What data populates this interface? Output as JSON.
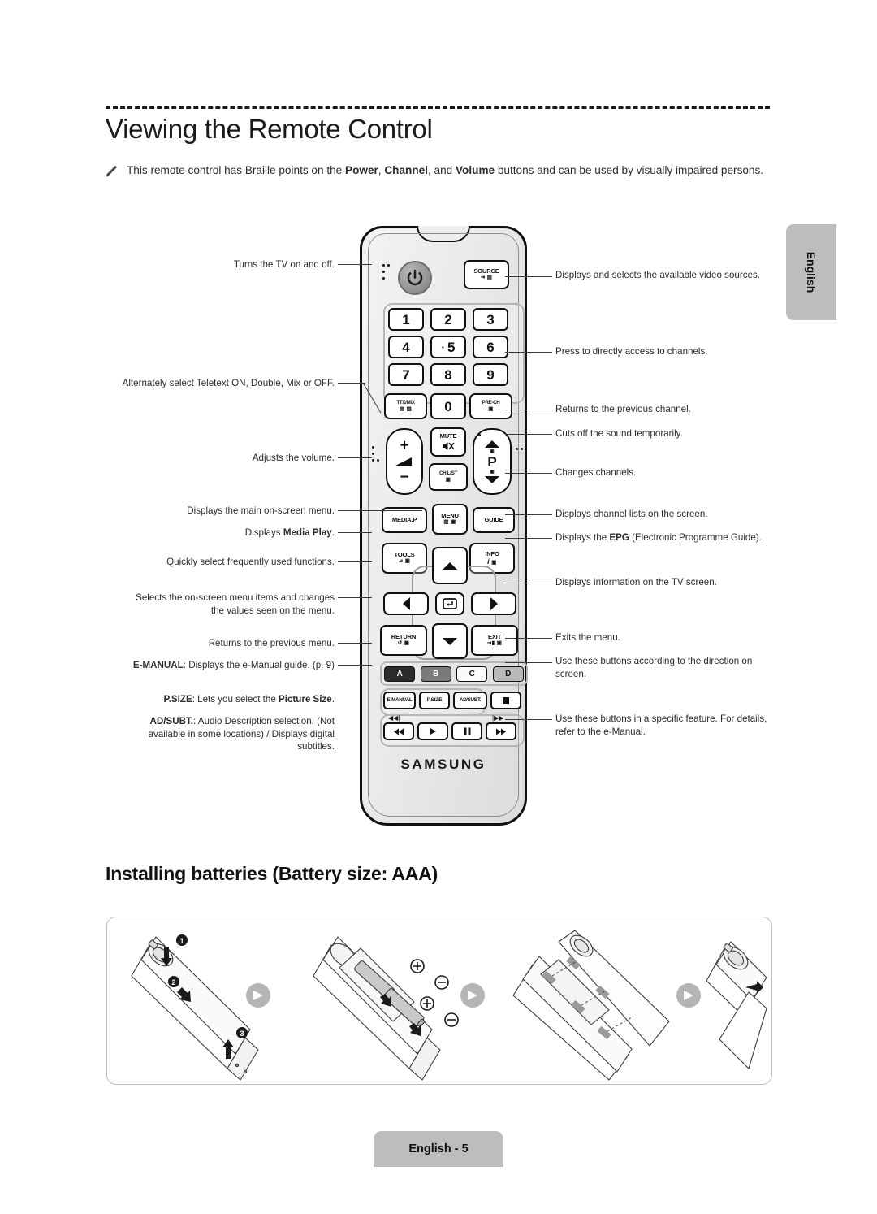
{
  "header": {
    "title": "Viewing the Remote Control",
    "note_icon": "pencil-note-icon",
    "note_parts": {
      "p1": "This remote control has Braille points on the ",
      "b1": "Power",
      "p2": ", ",
      "b2": "Channel",
      "p3": ", and ",
      "b3": "Volume",
      "p4": " buttons and can be used by visually impaired persons."
    }
  },
  "side_tab": {
    "label": "English"
  },
  "remote": {
    "brand": "SAMSUNG",
    "buttons": {
      "source": "SOURCE",
      "n1": "1",
      "n2": "2",
      "n3": "3",
      "n4": "4",
      "n5": "5",
      "n6": "6",
      "n7": "7",
      "n8": "8",
      "n9": "9",
      "n0": "0",
      "ttxmix": "TTX/MIX",
      "precch": "PRE-CH",
      "mute": "MUTE",
      "chlist": "CH LIST",
      "p": "P",
      "mediap": "MEDIA.P",
      "menu": "MENU",
      "guide": "GUIDE",
      "tools": "TOOLS",
      "info": "INFO",
      "return": "RETURN",
      "exit": "EXIT",
      "color_a": "A",
      "color_b": "B",
      "color_c": "C",
      "color_d": "D",
      "emanual": "E-MANUAL",
      "psize": "P.SIZE",
      "adsubt": "AD/SUBT."
    },
    "icons": {
      "power": "power-icon",
      "volume": "volume-icon",
      "plus": "plus-icon",
      "minus": "minus-icon",
      "up": "chevron-up-icon",
      "down": "chevron-down-icon",
      "left": "chevron-left-icon",
      "right": "chevron-right-icon",
      "enter": "enter-icon",
      "mute": "mute-speaker-icon",
      "stop": "stop-icon",
      "rewind": "rewind-icon",
      "play": "play-icon",
      "pause": "pause-icon",
      "fastforward": "fast-forward-icon",
      "prev_track": "previous-track-icon",
      "next_track": "next-track-icon"
    }
  },
  "annotations": {
    "left": [
      {
        "id": "power",
        "text": "Turns the TV on and off."
      },
      {
        "id": "ttxmix",
        "text": "Alternately select Teletext ON, Double, Mix or OFF."
      },
      {
        "id": "volume",
        "text": "Adjusts the volume."
      },
      {
        "id": "menu",
        "text": "Displays the main on-screen menu."
      },
      {
        "id": "mediap",
        "text": "Displays Media Play.",
        "bold": "Media Play"
      },
      {
        "id": "tools",
        "text": "Quickly select frequently used functions."
      },
      {
        "id": "arrows",
        "text": "Selects the on-screen menu items and changes the values seen on the menu."
      },
      {
        "id": "return",
        "text": "Returns to the previous menu."
      },
      {
        "id": "emanual",
        "text": "E-MANUAL: Displays the e-Manual guide. (p. 9)",
        "bold": "E-MANUAL"
      },
      {
        "id": "psize",
        "text": "P.SIZE: Lets you select the Picture Size.",
        "bold": "P.SIZE"
      },
      {
        "id": "adsubt",
        "text": "AD/SUBT.: Audio Description selection. (Not available in some locations) / Displays digital subtitles.",
        "bold": "AD/SUBT."
      }
    ],
    "right": [
      {
        "id": "source",
        "text": "Displays and selects the available video sources."
      },
      {
        "id": "numbers",
        "text": "Press to directly access to channels."
      },
      {
        "id": "precch",
        "text": "Returns to the previous channel."
      },
      {
        "id": "mute",
        "text": "Cuts off the sound temporarily."
      },
      {
        "id": "channel",
        "text": "Changes channels."
      },
      {
        "id": "chlist",
        "text": "Displays channel lists on the screen."
      },
      {
        "id": "guide",
        "text": "Displays the EPG (Electronic Programme Guide).",
        "bold": "EPG"
      },
      {
        "id": "info",
        "text": "Displays information on the TV screen."
      },
      {
        "id": "exit",
        "text": "Exits the menu."
      },
      {
        "id": "colors",
        "text": "Use these buttons according to the direction on screen."
      },
      {
        "id": "media",
        "text": "Use these buttons in a specific feature. For details, refer to the e-Manual."
      }
    ]
  },
  "battery_section": {
    "title": "Installing batteries (Battery size: AAA)",
    "step_markers": [
      "1",
      "2",
      "3"
    ],
    "polarity": [
      "+",
      "−",
      "+",
      "−"
    ]
  },
  "footer": {
    "label": "English - 5"
  }
}
